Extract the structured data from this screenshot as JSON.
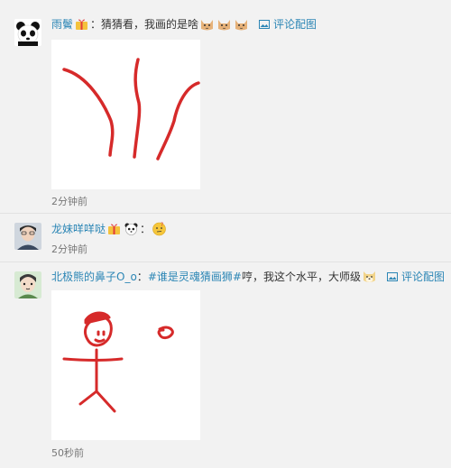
{
  "comments": [
    {
      "name": "雨鬢",
      "colon": "：",
      "text": "猜猜看，我画的是啥",
      "pic_link": "评论配图",
      "time": "2分钟前"
    },
    {
      "name": "龙妹咩咩哒",
      "colon": "：",
      "time": "2分钟前"
    },
    {
      "name": "北极熊的鼻子O_o",
      "colon": "：",
      "topic": "#谁是灵魂猜画狮#",
      "text": " 哼，我这个水平，大师级",
      "pic_link": "评论配图",
      "time": "50秒前"
    }
  ],
  "icons": {
    "avatar1": "panda-avatar",
    "avatar2": "boy-avatar",
    "avatar3": "cartoon-avatar",
    "pic": "image-icon"
  },
  "colors": {
    "link": "#2c86b5",
    "stroke": "#d62a2a",
    "background": "#f2f2f2"
  }
}
